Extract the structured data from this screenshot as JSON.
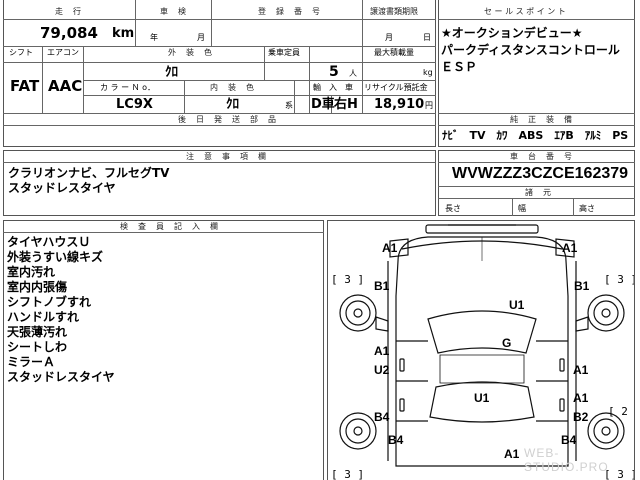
{
  "header": {
    "mileage_label": "走　行",
    "mileage_value": "79,084",
    "mileage_unit": "km",
    "inspection_label": "車　検",
    "inspection_year": "年",
    "inspection_month": "月",
    "registration_label": "登　録　番　号",
    "transfer_deadline_label": "譲渡書類期限",
    "transfer_month": "月",
    "transfer_day": "日"
  },
  "specs": {
    "shift_label": "シフト",
    "shift_value": "FAT",
    "aircon_label": "エアコン",
    "aircon_value": "AAC",
    "exterior_color_label": "外　装　色",
    "exterior_color_value": "ｸﾛ",
    "capacity_label": "乗車定員",
    "capacity_value": "5",
    "capacity_unit": "人",
    "max_load_label": "最大積載量",
    "max_load_unit": "kg",
    "color_no_label": "カ ラ ー Ｎ o．",
    "color_no_value": "LC9X",
    "interior_color_label": "内　装　色",
    "interior_color_value": "ｸﾛ",
    "interior_suffix": "系",
    "import_label": "輸　入　車",
    "drive_value": "D車",
    "steering_value": "右H",
    "recycle_label": "リサイクル預託金",
    "recycle_value": "18,910",
    "recycle_unit": "円",
    "aftermarket_label": "後　日　発　送　部　品"
  },
  "sales_points": {
    "label": "セ ー ル ス ポ イ ン ト",
    "lines": [
      "★オークションデビュー★",
      "パークディスタンスコントロール",
      "ＥＳＰ"
    ]
  },
  "genuine_equipment": {
    "label": "純　正　装　備",
    "items": "ﾅﾋﾞ　TV　ｶﾜ　ABS　ｴｱB　ｱﾙﾐ　PS　PW"
  },
  "notes": {
    "label": "注　意　事　項　欄",
    "lines": [
      "クラリオンナビ、フルセグTV",
      "スタッドレスタイヤ"
    ]
  },
  "chassis": {
    "label": "車　台　番　号",
    "value": "WVWZZZ3CZCE162379",
    "dims_label": "諸　元",
    "length_label": "長さ",
    "width_label": "幅",
    "height_label": "高さ"
  },
  "inspector": {
    "label": "検　査　員　記　入　欄",
    "lines": [
      "タイヤハウスＵ",
      "外装うすい線キズ",
      "室内汚れ",
      "室内内張傷",
      "シフトノブすれ",
      "ハンドルすれ",
      "天張薄汚れ",
      "シートしわ",
      "ミラーＡ",
      "スタッドレスタイヤ"
    ]
  },
  "damage_map": {
    "marks": [
      "A1",
      "A1",
      "B1",
      "B1",
      "U1",
      "G",
      "A1",
      "U2",
      "A1",
      "A1",
      "U1",
      "B4",
      "B2",
      "B4",
      "B4",
      "A1"
    ],
    "bracket_marks": [
      "[ 3 ]",
      "[ 3 ]",
      "[ 2",
      "[ 3 ]",
      "[ 3 ]"
    ]
  },
  "watermark": "WEB-STUDIO.PRO"
}
